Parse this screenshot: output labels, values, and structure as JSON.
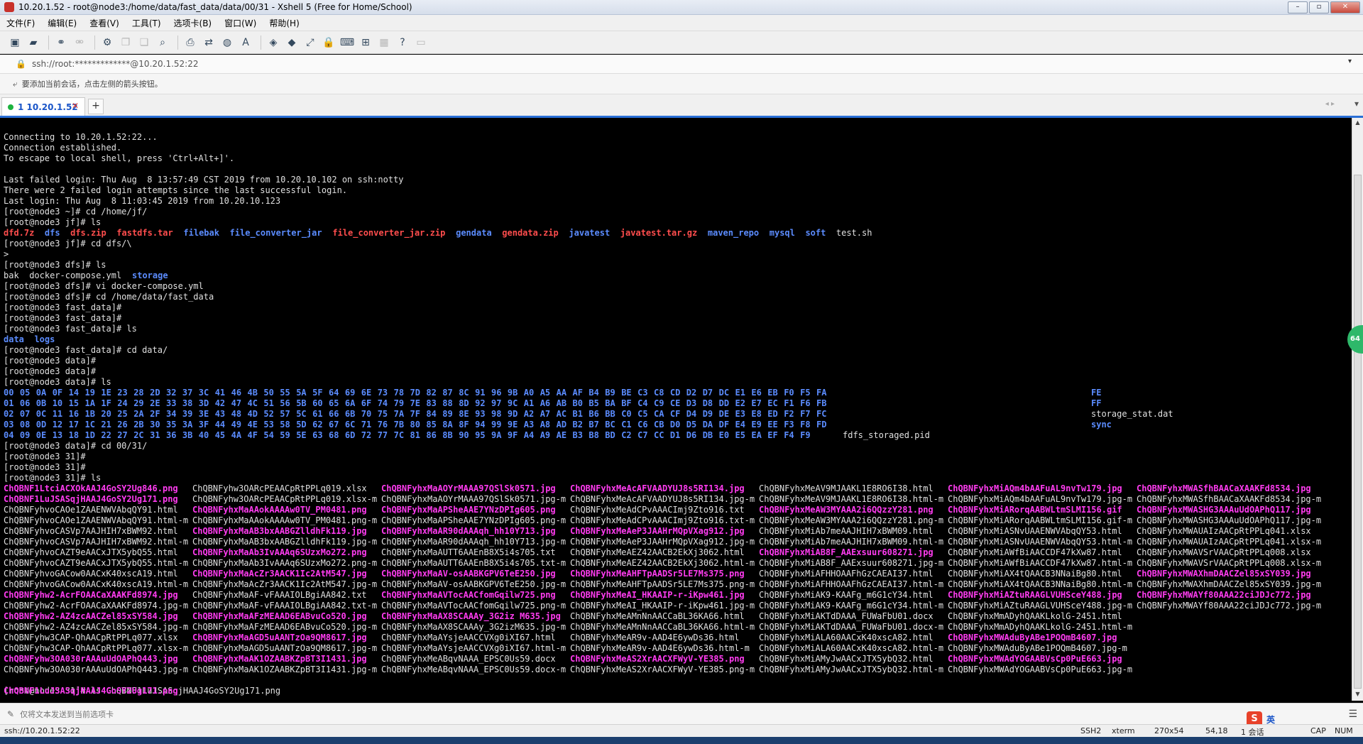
{
  "window": {
    "title": "10.20.1.52 - root@node3:/home/data/fast_data/data/00/31 - Xshell 5 (Free for Home/School)",
    "minimize": "–",
    "maximize": "▫",
    "close": "✕"
  },
  "menu": [
    "文件(F)",
    "编辑(E)",
    "查看(V)",
    "工具(T)",
    "选项卡(B)",
    "窗口(W)",
    "帮助(H)"
  ],
  "address": {
    "text": "ssh://root:*************@10.20.1.52:22",
    "dropdown": "▾"
  },
  "hint": "要添加当前会话，点击左侧的箭头按钮。",
  "tab": {
    "label": "1 10.20.1.52",
    "close": "✕",
    "add": "+"
  },
  "terminal": {
    "lines": [
      "Connecting to 10.20.1.52:22...",
      "Connection established.",
      "To escape to local shell, press 'Ctrl+Alt+]'.",
      "",
      "Last failed login: Thu Aug  8 13:57:49 CST 2019 from 10.20.10.102 on ssh:notty",
      "There were 2 failed login attempts since the last successful login.",
      "Last login: Thu Aug  8 11:03:45 2019 from 10.20.10.123",
      "[root@node3 ~]# cd /home/jf/",
      "[root@node3 jf]# ls",
      "",
      "[root@node3 jf]# cd dfs/\\",
      ">",
      "[root@node3 dfs]# ls",
      "",
      "[root@node3 dfs]# vi docker-compose.yml",
      "[root@node3 dfs]# cd /home/data/fast_data",
      "[root@node3 fast_data]#",
      "[root@node3 fast_data]#",
      "[root@node3 fast_data]# ls",
      "",
      "[root@node3 fast_data]# cd data/",
      "[root@node3 data]#",
      "[root@node3 data]#",
      "[root@node3 data]# ls",
      "",
      "",
      "",
      "",
      "",
      "[root@node3 data]# cd 00/31/",
      "[root@node3 31]#",
      "[root@node3 31]#",
      "[root@node3 31]# ls",
      "",
      "",
      "",
      "",
      "",
      "",
      "",
      "",
      "",
      "",
      "",
      "",
      "",
      "",
      "",
      "",
      "",
      "",
      "",
      "[root@node3 31]# ls ChQBNF1LuJSASqjHAAJ4GoSY2Ug171.png",
      ""
    ],
    "jf_ls": [
      {
        "t": "dfd.7z",
        "c": "red"
      },
      {
        "t": "dfs",
        "c": "dir"
      },
      {
        "t": "dfs.zip",
        "c": "red"
      },
      {
        "t": "fastdfs.tar",
        "c": "red"
      },
      {
        "t": "filebak",
        "c": "dir"
      },
      {
        "t": "file_converter_jar",
        "c": "dir"
      },
      {
        "t": "file_converter_jar.zip",
        "c": "red"
      },
      {
        "t": "gendata",
        "c": "dir"
      },
      {
        "t": "gendata.zip",
        "c": "red"
      },
      {
        "t": "javatest",
        "c": "dir"
      },
      {
        "t": "javatest.tar.gz",
        "c": "red"
      },
      {
        "t": "maven_repo",
        "c": "dir"
      },
      {
        "t": "mysql",
        "c": "dir"
      },
      {
        "t": "soft",
        "c": "dir"
      },
      {
        "t": "test.sh",
        "c": "plain"
      }
    ],
    "dfs_ls": [
      {
        "t": "bak",
        "c": "plain"
      },
      {
        "t": "docker-compose.yml",
        "c": "plain"
      },
      {
        "t": "storage",
        "c": "dir"
      }
    ],
    "fastdata_ls": [
      {
        "t": "data",
        "c": "dir"
      },
      {
        "t": "logs",
        "c": "dir"
      }
    ],
    "hex_rows": [
      "00 05 0A 0F 14 19 1E 23 28 2D 32 37 3C 41 46 4B 50 55 5A 5F 64 69 6E 73 78 7D 82 87 8C 91 96 9B A0 A5 AA AF B4 B9 BE C3 C8 CD D2 D7 DC E1 E6 EB F0 F5 FA",
      "01 06 0B 10 15 1A 1F 24 29 2E 33 38 3D 42 47 4C 51 56 5B 60 65 6A 6F 74 79 7E 83 88 8D 92 97 9C A1 A6 AB B0 B5 BA BF C4 C9 CE D3 D8 DD E2 E7 EC F1 F6 FB",
      "02 07 0C 11 16 1B 20 25 2A 2F 34 39 3E 43 48 4D 52 57 5C 61 66 6B 70 75 7A 7F 84 89 8E 93 98 9D A2 A7 AC B1 B6 BB C0 C5 CA CF D4 D9 DE E3 E8 ED F2 F7 FC",
      "03 08 0D 12 17 1C 21 26 2B 30 35 3A 3F 44 49 4E 53 58 5D 62 67 6C 71 76 7B 80 85 8A 8F 94 99 9E A3 A8 AD B2 B7 BC C1 C6 CB D0 D5 DA DF E4 E9 EE F3 F8 FD",
      "04 09 0E 13 18 1D 22 27 2C 31 36 3B 40 45 4A 4F 54 59 5E 63 68 6D 72 77 7C 81 86 8B 90 95 9A 9F A4 A9 AE B3 B8 BD C2 C7 CC D1 D6 DB E0 E5 EA EF F4 F9"
    ],
    "hex_extra": [
      {
        "t": "FE",
        "c": "dir"
      },
      {
        "t": "FF",
        "c": "dir"
      },
      {
        "t": "storage_stat.dat",
        "c": "plain"
      },
      {
        "t": "sync",
        "c": "dir"
      },
      {
        "t": "fdfs_storaged.pid",
        "c": "plain",
        "left": true
      }
    ],
    "files_cols": [
      [
        {
          "t": "ChQBNF1LtciACXOkAAJ4GoSY2Ug846.png",
          "c": "img"
        },
        {
          "t": "ChQBNF1LuJSASqjHAAJ4GoSY2Ug171.png",
          "c": "img"
        },
        {
          "t": "ChQBNFyhvoCAOe1ZAAENWVAbqQY91.html",
          "c": "plain"
        },
        {
          "t": "ChQBNFyhvoCAOe1ZAAENWVAbqQY91.html-m",
          "c": "plain"
        },
        {
          "t": "ChQBNFyhvoCASVp7AAJHIH7xBWM92.html",
          "c": "plain"
        },
        {
          "t": "ChQBNFyhvoCASVp7AAJHIH7xBWM92.html-m",
          "c": "plain"
        },
        {
          "t": "ChQBNFyhvoCAZT9eAACxJTX5ybQ55.html",
          "c": "plain"
        },
        {
          "t": "ChQBNFyhvoCAZT9eAACxJTX5ybQ55.html-m",
          "c": "plain"
        },
        {
          "t": "ChQBNFyhvoGACow0AACxK40xscA19.html",
          "c": "plain"
        },
        {
          "t": "ChQBNFyhvoGACow0AACxK40xscA19.html-m",
          "c": "plain"
        },
        {
          "t": "ChQBNFyhw2-AcrFOAACaXAAKFd8974.jpg",
          "c": "img"
        },
        {
          "t": "ChQBNFyhw2-AcrFOAACaXAAKFd8974.jpg-m",
          "c": "plain"
        },
        {
          "t": "ChQBNFyhw2-AZ4zcAACZel85xSY584.jpg",
          "c": "img"
        },
        {
          "t": "ChQBNFyhw2-AZ4zcAACZel85xSY584.jpg-m",
          "c": "plain"
        },
        {
          "t": "ChQBNFyhw3CAP-QhAACpRtPPLq077.xlsx",
          "c": "plain"
        },
        {
          "t": "ChQBNFyhw3CAP-QhAACpRtPPLq077.xlsx-m",
          "c": "plain"
        },
        {
          "t": "ChQBNFyhw3OA030rAAAuUdOAPhQ443.jpg",
          "c": "img"
        },
        {
          "t": "ChQBNFyhw3OA030rAAAuUdOAPhQ443.jpg-m",
          "c": "plain"
        }
      ],
      [
        {
          "t": "ChQBNFyhw3OARcPEAACpRtPPLq019.xlsx",
          "c": "plain"
        },
        {
          "t": "ChQBNFyhw3OARcPEAACpRtPPLq019.xlsx-m",
          "c": "plain"
        },
        {
          "t": "ChQBNFyhxMaAAokAAAAw0TV_PM0481.png",
          "c": "img"
        },
        {
          "t": "ChQBNFyhxMaAAokAAAAw0TV_PM0481.png-m",
          "c": "plain"
        },
        {
          "t": "ChQBNFyhxMaAB3bxAABGZlldhFk119.jpg",
          "c": "img"
        },
        {
          "t": "ChQBNFyhxMaAB3bxAABGZlldhFk119.jpg-m",
          "c": "plain"
        },
        {
          "t": "ChQBNFyhxMaAb3IvAAAq6SUzxMo272.png",
          "c": "img"
        },
        {
          "t": "ChQBNFyhxMaAb3IvAAAq6SUzxMo272.png-m",
          "c": "plain"
        },
        {
          "t": "ChQBNFyhxMaAcZr3AACK1Ic2AtM547.jpg",
          "c": "img"
        },
        {
          "t": "ChQBNFyhxMaAcZr3AACK1Ic2AtM547.jpg-m",
          "c": "plain"
        },
        {
          "t": "ChQBNFyhxMaAF-vFAAAIOLBgiAA842.txt",
          "c": "plain"
        },
        {
          "t": "ChQBNFyhxMaAF-vFAAAIOLBgiAA842.txt-m",
          "c": "plain"
        },
        {
          "t": "ChQBNFyhxMaAFzMEAAD6EABvuCo520.jpg",
          "c": "img"
        },
        {
          "t": "ChQBNFyhxMaAFzMEAAD6EABvuCo520.jpg-m",
          "c": "plain"
        },
        {
          "t": "ChQBNFyhxMaAGD5uAANTzOa9QM8617.jpg",
          "c": "img"
        },
        {
          "t": "ChQBNFyhxMaAGD5uAANTzOa9QM8617.jpg-m",
          "c": "plain"
        },
        {
          "t": "ChQBNFyhxMaAK1OZAABKZpBT3I1431.jpg",
          "c": "img"
        },
        {
          "t": "ChQBNFyhxMaAK1OZAABKZpBT3I1431.jpg-m",
          "c": "plain"
        }
      ],
      [
        {
          "t": "ChQBNFyhxMaAOYrMAAA97QSlSk0571.jpg",
          "c": "img"
        },
        {
          "t": "ChQBNFyhxMaAOYrMAAA97QSlSk0571.jpg-m",
          "c": "plain"
        },
        {
          "t": "ChQBNFyhxMaAPSheAAE7YNzDPIg605.png",
          "c": "img"
        },
        {
          "t": "ChQBNFyhxMaAPSheAAE7YNzDPIg605.png-m",
          "c": "plain"
        },
        {
          "t": "ChQBNFyhxMaAR90dAAAqh_hh10Y713.jpg",
          "c": "img"
        },
        {
          "t": "ChQBNFyhxMaAR90dAAAqh_hh10Y713.jpg-m",
          "c": "plain"
        },
        {
          "t": "ChQBNFyhxMaAUTT6AAEnB8X5i4s705.txt",
          "c": "plain"
        },
        {
          "t": "ChQBNFyhxMaAUTT6AAEnB8X5i4s705.txt-m",
          "c": "plain"
        },
        {
          "t": "ChQBNFyhxMaAV-osAABKGPV6TeE250.jpg",
          "c": "img"
        },
        {
          "t": "ChQBNFyhxMaAV-osAABKGPV6TeE250.jpg-m",
          "c": "plain"
        },
        {
          "t": "ChQBNFyhxMaAVTocAACfomGqilw725.png",
          "c": "img"
        },
        {
          "t": "ChQBNFyhxMaAVTocAACfomGqilw725.png-m",
          "c": "plain"
        },
        {
          "t": "ChQBNFyhxMaAX8SCAAAy_3G2iz M635.jpg",
          "c": "img"
        },
        {
          "t": "ChQBNFyhxMaAX8SCAAAy_3G2izM635.jpg-m",
          "c": "plain"
        },
        {
          "t": "ChQBNFyhxMaAYsjeAACCVXg0iXI67.html",
          "c": "plain"
        },
        {
          "t": "ChQBNFyhxMaAYsjeAACCVXg0iXI67.html-m",
          "c": "plain"
        },
        {
          "t": "ChQBNFyhxMeABqvNAAA_EPSC0Us59.docx",
          "c": "plain"
        },
        {
          "t": "ChQBNFyhxMeABqvNAAA_EPSC0Us59.docx-m",
          "c": "plain"
        }
      ],
      [
        {
          "t": "ChQBNFyhxMeAcAFVAADYUJ8s5RI134.jpg",
          "c": "img"
        },
        {
          "t": "ChQBNFyhxMeAcAFVAADYUJ8s5RI134.jpg-m",
          "c": "plain"
        },
        {
          "t": "ChQBNFyhxMeAdCPvAAACImj9Zto916.txt",
          "c": "plain"
        },
        {
          "t": "ChQBNFyhxMeAdCPvAAACImj9Zto916.txt-m",
          "c": "plain"
        },
        {
          "t": "ChQBNFyhxMeAeP3JAAHrMQpVXag912.jpg",
          "c": "img"
        },
        {
          "t": "ChQBNFyhxMeAeP3JAAHrMQpVXag912.jpg-m",
          "c": "plain"
        },
        {
          "t": "ChQBNFyhxMeAEZ42AACB2EkXj3062.html",
          "c": "plain"
        },
        {
          "t": "ChQBNFyhxMeAEZ42AACB2EkXj3062.html-m",
          "c": "plain"
        },
        {
          "t": "ChQBNFyhxMeAHFTpAADSr5LE7Ms375.png",
          "c": "img"
        },
        {
          "t": "ChQBNFyhxMeAHFTpAADSr5LE7Ms375.png-m",
          "c": "plain"
        },
        {
          "t": "ChQBNFyhxMeAI_HKAAIP-r-iKpw461.jpg",
          "c": "img"
        },
        {
          "t": "ChQBNFyhxMeAI_HKAAIP-r-iKpw461.jpg-m",
          "c": "plain"
        },
        {
          "t": "ChQBNFyhxMeAMnNnAACCaBL36KA66.html",
          "c": "plain"
        },
        {
          "t": "ChQBNFyhxMeAMnNnAACCaBL36KA66.html-m",
          "c": "plain"
        },
        {
          "t": "ChQBNFyhxMeAR9v-AAD4E6ywDs36.html",
          "c": "plain"
        },
        {
          "t": "ChQBNFyhxMeAR9v-AAD4E6ywDs36.html-m",
          "c": "plain"
        },
        {
          "t": "ChQBNFyhxMeAS2XrAACXFWyV-YE385.png",
          "c": "img"
        },
        {
          "t": "ChQBNFyhxMeAS2XrAACXFWyV-YE385.png-m",
          "c": "plain"
        }
      ],
      [
        {
          "t": "ChQBNFyhxMeAV9MJAAKL1E8RO6I38.html",
          "c": "plain"
        },
        {
          "t": "ChQBNFyhxMeAV9MJAAKL1E8RO6I38.html-m",
          "c": "plain"
        },
        {
          "t": "ChQBNFyhxMeAW3MYAAA2i6QQzzY281.png",
          "c": "img"
        },
        {
          "t": "ChQBNFyhxMeAW3MYAAA2i6QQzzY281.png-m",
          "c": "plain"
        },
        {
          "t": "ChQBNFyhxMiAb7meAAJHIH7xBWM09.html",
          "c": "plain"
        },
        {
          "t": "ChQBNFyhxMiAb7meAAJHIH7xBWM09.html-m",
          "c": "plain"
        },
        {
          "t": "ChQBNFyhxMiAB8F_AAExsuur608271.jpg",
          "c": "img"
        },
        {
          "t": "ChQBNFyhxMiAB8F_AAExsuur608271.jpg-m",
          "c": "plain"
        },
        {
          "t": "ChQBNFyhxMiAFHHOAAFhGzCAEAI37.html",
          "c": "plain"
        },
        {
          "t": "ChQBNFyhxMiAFHHOAAFhGzCAEAI37.html-m",
          "c": "plain"
        },
        {
          "t": "ChQBNFyhxMiAK9-KAAFg_m6G1cY34.html",
          "c": "plain"
        },
        {
          "t": "ChQBNFyhxMiAK9-KAAFg_m6G1cY34.html-m",
          "c": "plain"
        },
        {
          "t": "ChQBNFyhxMiAKTdDAAA_FUWaFbU01.docx",
          "c": "plain"
        },
        {
          "t": "ChQBNFyhxMiAKTdDAAA_FUWaFbU01.docx-m",
          "c": "plain"
        },
        {
          "t": "ChQBNFyhxMiALA60AACxK40xscA82.html",
          "c": "plain"
        },
        {
          "t": "ChQBNFyhxMiALA60AACxK40xscA82.html-m",
          "c": "plain"
        },
        {
          "t": "ChQBNFyhxMiAMyJwAACxJTX5ybQ32.html",
          "c": "plain"
        },
        {
          "t": "ChQBNFyhxMiAMyJwAACxJTX5ybQ32.html-m",
          "c": "plain"
        }
      ],
      [
        {
          "t": "ChQBNFyhxMiAQm4bAAFuAL9nvTw179.jpg",
          "c": "img"
        },
        {
          "t": "ChQBNFyhxMiAQm4bAAFuAL9nvTw179.jpg-m",
          "c": "plain"
        },
        {
          "t": "ChQBNFyhxMiARorqAABWLtmSLMI156.gif",
          "c": "img"
        },
        {
          "t": "ChQBNFyhxMiARorqAABWLtmSLMI156.gif-m",
          "c": "plain"
        },
        {
          "t": "ChQBNFyhxMiASNvUAAENWVAbqQY53.html",
          "c": "plain"
        },
        {
          "t": "ChQBNFyhxMiASNvUAAENWVAbqQY53.html-m",
          "c": "plain"
        },
        {
          "t": "ChQBNFyhxMiAWfBiAACCDF47kXw87.html",
          "c": "plain"
        },
        {
          "t": "ChQBNFyhxMiAWfBiAACCDF47kXw87.html-m",
          "c": "plain"
        },
        {
          "t": "ChQBNFyhxMiAX4tQAACB3NNaiBg80.html",
          "c": "plain"
        },
        {
          "t": "ChQBNFyhxMiAX4tQAACB3NNaiBg80.html-m",
          "c": "plain"
        },
        {
          "t": "ChQBNFyhxMiAZtuRAAGLVUHSceY488.jpg",
          "c": "img"
        },
        {
          "t": "ChQBNFyhxMiAZtuRAAGLVUHSceY488.jpg-m",
          "c": "plain"
        },
        {
          "t": "ChQBNFyhxMmADyhQAAKLkolG-2451.html",
          "c": "plain"
        },
        {
          "t": "ChQBNFyhxMmADyhQAAKLkolG-2451.html-m",
          "c": "plain"
        },
        {
          "t": "ChQBNFyhxMWAduByABe1POQmB4607.jpg",
          "c": "img"
        },
        {
          "t": "ChQBNFyhxMWAduByABe1POQmB4607.jpg-m",
          "c": "plain"
        },
        {
          "t": "ChQBNFyhxMWAdYOGAABVsCp0PuE663.jpg",
          "c": "img"
        },
        {
          "t": "ChQBNFyhxMWAdYOGAABVsCp0PuE663.jpg-m",
          "c": "plain"
        }
      ],
      [
        {
          "t": "ChQBNFyhxMWASfhBAACaXAAKFd8534.jpg",
          "c": "img"
        },
        {
          "t": "ChQBNFyhxMWASfhBAACaXAAKFd8534.jpg-m",
          "c": "plain"
        },
        {
          "t": "ChQBNFyhxMWASHG3AAAuUdOAPhQ117.jpg",
          "c": "img"
        },
        {
          "t": "ChQBNFyhxMWASHG3AAAuUdOAPhQ117.jpg-m",
          "c": "plain"
        },
        {
          "t": "ChQBNFyhxMWAUAIzAACpRtPPLq041.xlsx",
          "c": "plain"
        },
        {
          "t": "ChQBNFyhxMWAUAIzAACpRtPPLq041.xlsx-m",
          "c": "plain"
        },
        {
          "t": "ChQBNFyhxMWAVSrVAACpRtPPLq008.xlsx",
          "c": "plain"
        },
        {
          "t": "ChQBNFyhxMWAVSrVAACpRtPPLq008.xlsx-m",
          "c": "plain"
        },
        {
          "t": "ChQBNFyhxMWAXhmDAACZel85xSY039.jpg",
          "c": "img"
        },
        {
          "t": "ChQBNFyhxMWAXhmDAACZel85xSY039.jpg-m",
          "c": "plain"
        },
        {
          "t": "ChQBNFyhxMWAYf80AAA22ciJDJc772.jpg",
          "c": "img"
        },
        {
          "t": "ChQBNFyhxMWAYf80AAA22ciJDJc772.jpg-m",
          "c": "plain"
        }
      ]
    ],
    "last_output": {
      "t": "ChQBNF1LuJSASqjHAAJ4GoSY2Ug171.png",
      "c": "img"
    }
  },
  "compose": {
    "placeholder": "仅将文本发送到当前选项卡"
  },
  "status": {
    "left": "ssh://10.20.1.52:22",
    "proto": "SSH2",
    "term": "xterm",
    "size": "270x54",
    "pos": "54,18",
    "sessions": "1 会话",
    "caps": "CAP",
    "num": "NUM"
  },
  "ime": {
    "logo": "S",
    "lang": "英"
  },
  "colors": {
    "dir": "#5b8cff",
    "archive": "#ff4d4d",
    "image": "#ff3cf0",
    "accent": "#2a6fd6"
  }
}
